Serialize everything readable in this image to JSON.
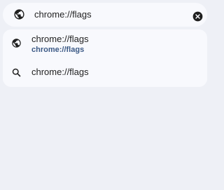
{
  "omnibox": {
    "icon": "globe-icon",
    "value": "chrome://flags",
    "clear_icon": "clear-icon"
  },
  "suggestions": [
    {
      "icon": "globe-icon",
      "primary": "chrome://flags",
      "secondary": "chrome://flags"
    },
    {
      "icon": "search-icon",
      "primary": "chrome://flags"
    }
  ],
  "colors": {
    "background": "#eef0f6",
    "surface": "#f8f9fd",
    "text": "#1f1f1f",
    "url_accent": "#3c5a86"
  }
}
